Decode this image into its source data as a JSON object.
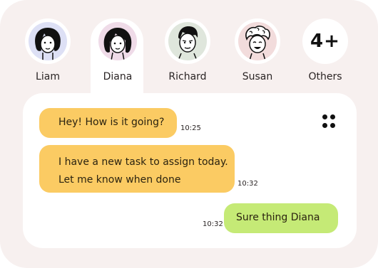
{
  "contacts": [
    {
      "name": "Liam",
      "avatar_bg": "#dde0f5"
    },
    {
      "name": "Diana",
      "avatar_bg": "#efdbe8",
      "active": true
    },
    {
      "name": "Richard",
      "avatar_bg": "#dfe6dc"
    },
    {
      "name": "Susan",
      "avatar_bg": "#f2dcdc"
    },
    {
      "name": "Others",
      "count": "4+"
    }
  ],
  "messages": [
    {
      "text_lines": [
        "Hey! How is it going?"
      ],
      "time": "10:25",
      "side": "incoming",
      "color": "#fbcb63"
    },
    {
      "text_lines": [
        "I have a new task to assign today.",
        "Let me know when done"
      ],
      "time": "10:32",
      "side": "incoming",
      "color": "#fbcb63"
    },
    {
      "text_lines": [
        "Sure thing Diana"
      ],
      "time": "10:32",
      "side": "outgoing",
      "color": "#c5ea76"
    }
  ],
  "icons": {
    "menu": "four-dot-menu-icon"
  }
}
